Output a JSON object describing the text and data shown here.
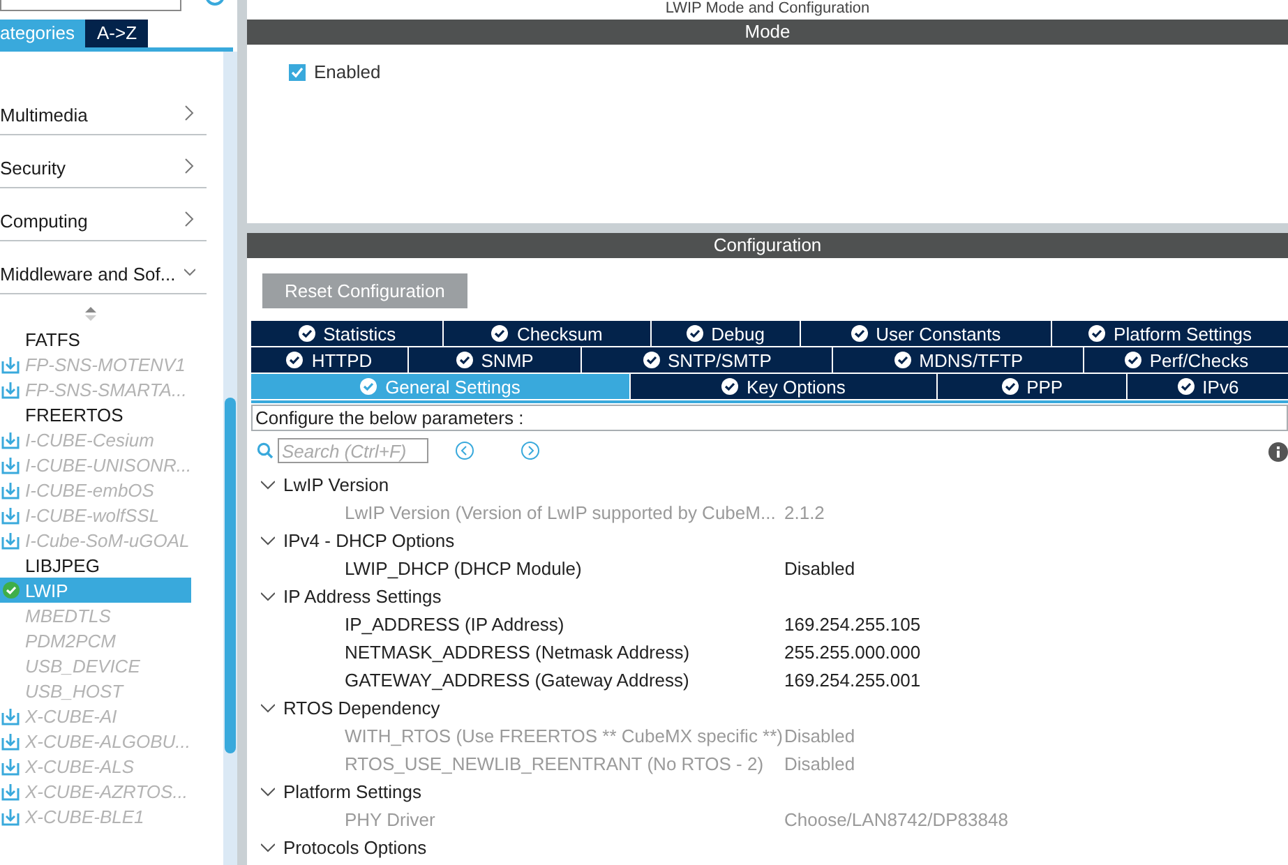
{
  "sidebar": {
    "view_tabs": [
      {
        "label": "ategories",
        "selected": true
      },
      {
        "label": "A->Z",
        "selected": false
      }
    ],
    "categories": [
      {
        "label": "Multimedia",
        "expanded": false
      },
      {
        "label": "Security",
        "expanded": false
      },
      {
        "label": "Computing",
        "expanded": false
      },
      {
        "label": "Middleware and Sof...",
        "expanded": true
      }
    ],
    "items": [
      {
        "label": "FATFS",
        "kind": "builtin",
        "selected": false
      },
      {
        "label": "FP-SNS-MOTENV1",
        "kind": "pack",
        "selected": false
      },
      {
        "label": "FP-SNS-SMARTA...",
        "kind": "pack",
        "selected": false
      },
      {
        "label": "FREERTOS",
        "kind": "builtin",
        "selected": false
      },
      {
        "label": "I-CUBE-Cesium",
        "kind": "pack",
        "selected": false
      },
      {
        "label": "I-CUBE-UNISONR...",
        "kind": "pack",
        "selected": false
      },
      {
        "label": "I-CUBE-embOS",
        "kind": "pack",
        "selected": false
      },
      {
        "label": "I-CUBE-wolfSSL",
        "kind": "pack",
        "selected": false
      },
      {
        "label": "I-Cube-SoM-uGOAL",
        "kind": "pack",
        "selected": false
      },
      {
        "label": "LIBJPEG",
        "kind": "builtin",
        "selected": false
      },
      {
        "label": "LWIP",
        "kind": "enabled",
        "selected": true
      },
      {
        "label": "MBEDTLS",
        "kind": "unavailable",
        "selected": false
      },
      {
        "label": "PDM2PCM",
        "kind": "unavailable",
        "selected": false
      },
      {
        "label": "USB_DEVICE",
        "kind": "unavailable",
        "selected": false
      },
      {
        "label": "USB_HOST",
        "kind": "unavailable",
        "selected": false
      },
      {
        "label": "X-CUBE-AI",
        "kind": "pack",
        "selected": false
      },
      {
        "label": "X-CUBE-ALGOBU...",
        "kind": "pack",
        "selected": false
      },
      {
        "label": "X-CUBE-ALS",
        "kind": "pack",
        "selected": false
      },
      {
        "label": "X-CUBE-AZRTOS...",
        "kind": "pack",
        "selected": false
      },
      {
        "label": "X-CUBE-BLE1",
        "kind": "pack",
        "selected": false
      }
    ]
  },
  "main": {
    "title": "LWIP Mode and Configuration",
    "mode": {
      "header": "Mode",
      "enabled": {
        "label": "Enabled",
        "checked": true
      }
    },
    "configuration": {
      "header": "Configuration",
      "reset_button": "Reset Configuration",
      "tab_rows": [
        [
          {
            "label": "Statistics",
            "selected": false
          },
          {
            "label": "Checksum",
            "selected": false
          },
          {
            "label": "Debug",
            "selected": false
          },
          {
            "label": "User Constants",
            "selected": false
          },
          {
            "label": "Platform Settings",
            "selected": false
          }
        ],
        [
          {
            "label": "HTTPD",
            "selected": false
          },
          {
            "label": "SNMP",
            "selected": false
          },
          {
            "label": "SNTP/SMTP",
            "selected": false
          },
          {
            "label": "MDNS/TFTP",
            "selected": false
          },
          {
            "label": "Perf/Checks",
            "selected": false
          }
        ],
        [
          {
            "label": "General Settings",
            "selected": true
          },
          {
            "label": "Key Options",
            "selected": false
          },
          {
            "label": "PPP",
            "selected": false
          },
          {
            "label": "IPv6",
            "selected": false
          }
        ]
      ],
      "hint": "Configure the below parameters :",
      "search": {
        "placeholder": "Search (Ctrl+F)"
      },
      "groups": [
        {
          "label": "LwIP Version",
          "expanded": true,
          "children": [
            {
              "name": "LwIP Version (Version of LwIP supported by CubeM...",
              "value": "2.1.2",
              "disabled": true
            }
          ]
        },
        {
          "label": "IPv4 - DHCP Options",
          "expanded": true,
          "children": [
            {
              "name": "LWIP_DHCP (DHCP Module)",
              "value": "Disabled",
              "disabled": false
            }
          ]
        },
        {
          "label": "IP Address Settings",
          "expanded": true,
          "children": [
            {
              "name": "IP_ADDRESS (IP Address)",
              "value": "169.254.255.105",
              "disabled": false
            },
            {
              "name": "NETMASK_ADDRESS (Netmask Address)",
              "value": "255.255.000.000",
              "disabled": false
            },
            {
              "name": "GATEWAY_ADDRESS (Gateway Address)",
              "value": "169.254.255.001",
              "disabled": false
            }
          ]
        },
        {
          "label": "RTOS Dependency",
          "expanded": true,
          "children": [
            {
              "name": "WITH_RTOS (Use FREERTOS ** CubeMX specific **)",
              "value": "Disabled",
              "disabled": true
            },
            {
              "name": "RTOS_USE_NEWLIB_REENTRANT (No RTOS - 2)",
              "value": "Disabled",
              "disabled": true
            }
          ]
        },
        {
          "label": "Platform Settings",
          "expanded": true,
          "children": [
            {
              "name": "PHY Driver",
              "value": "Choose/LAN8742/DP83848",
              "disabled": true
            }
          ]
        },
        {
          "label": "Protocols Options",
          "expanded": true
        }
      ]
    }
  }
}
